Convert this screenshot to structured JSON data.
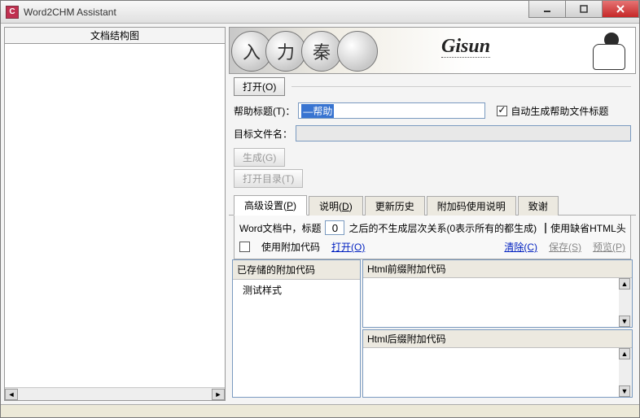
{
  "window": {
    "title": "Word2CHM Assistant"
  },
  "left": {
    "header": "文档结构图"
  },
  "banner": {
    "disc1": "入",
    "disc2": "力",
    "disc3": "秦",
    "brand": "Gisun"
  },
  "toolbar": {
    "open_btn": "打开(O)"
  },
  "form": {
    "help_title_label": "帮助标题(T)：",
    "help_title_value": "—帮助",
    "auto_gen_label": "自动生成帮助文件标题",
    "auto_gen_checked": true,
    "target_label": "目标文件名：",
    "target_value": "",
    "generate_btn": "生成(G)",
    "open_dir_btn": "打开目录(T)"
  },
  "tabs": {
    "items": [
      {
        "label": "高级设置",
        "key": "P",
        "active": true
      },
      {
        "label": "说明",
        "key": "D",
        "active": false
      },
      {
        "label": "更新历史",
        "key": "",
        "active": false
      },
      {
        "label": "附加码使用说明",
        "key": "",
        "active": false
      },
      {
        "label": "致谢",
        "key": "",
        "active": false
      }
    ]
  },
  "adv": {
    "prefix": "Word文档中，标题",
    "level_value": "0",
    "suffix": "之后的不生成层次关系(0表示所有的都生成)",
    "use_default_html": "使用缺省HTML头",
    "use_extra_code": "使用附加代码",
    "link_open": "打开(O)",
    "link_clear": "清除(C)",
    "link_save": "保存(S)",
    "link_preview": "预览(P)"
  },
  "stored": {
    "header": "已存储的附加代码",
    "item0": "测试样式"
  },
  "html_pre": {
    "header": "Html前缀附加代码"
  },
  "html_suf": {
    "header": "Html后缀附加代码"
  }
}
